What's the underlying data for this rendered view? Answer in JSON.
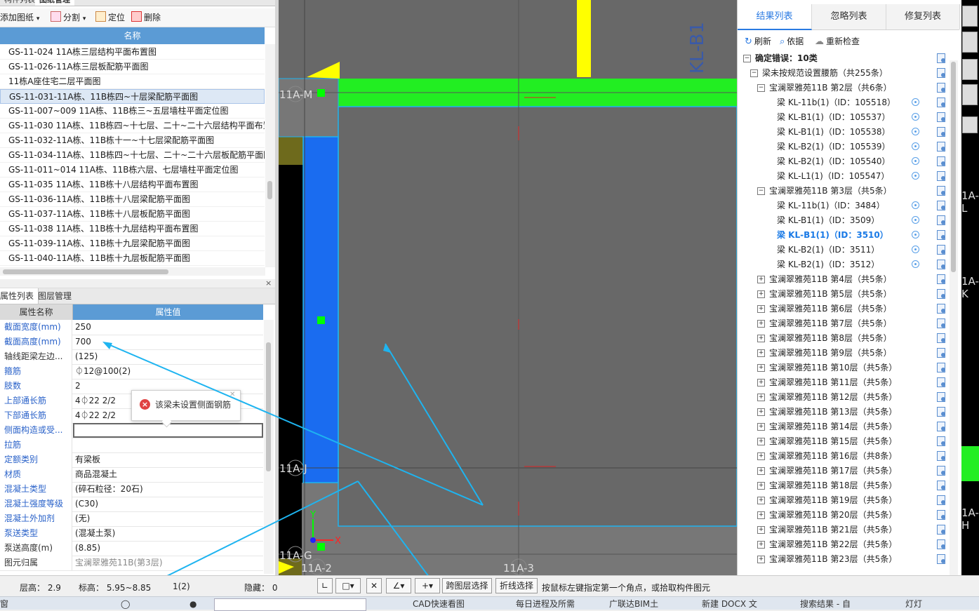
{
  "drawing_panel": {
    "tabs": [
      "构件列表",
      "图纸管理"
    ],
    "toolbar": {
      "add": "添加图纸",
      "split": "分割",
      "locate": "定位",
      "delete": "删除"
    },
    "header": "名称",
    "rows": [
      "GS-11-024 11A栋三层结构平面布置图",
      "GS-11-026-11A栋三层板配筋平面图",
      "11栋A座住宅二层平面图",
      "GS-11-031-11A栋、11B栋四~十层梁配筋平面图",
      "GS-11-007~009 11A栋、11B栋三~五层墙柱平面定位图",
      "GS-11-030 11A栋、11B栋四~十七层、二十~二十六层结构平面布置",
      "GS-11-032-11A栋、11B栋十一~十七层梁配筋平面图",
      "GS-11-034-11A栋、11B栋四~十七层、二十~二十六层板配筋平面图",
      "GS-11-011~014 11A栋、11B栋六层、七层墙柱平面定位图",
      "GS-11-035 11A栋、11B栋十八层结构平面布置图",
      "GS-11-036-11A栋、11B栋十八层梁配筋平面图",
      "GS-11-037-11A栋、11B栋十八层板配筋平面图",
      "GS-11-038 11A栋、11B栋十九层结构平面布置图",
      "GS-11-039-11A栋、11B栋十九层梁配筋平面图",
      "GS-11-040-11A栋、11B栋十九层板配筋平面图"
    ],
    "selected_index": 3
  },
  "property_panel": {
    "tabs": [
      "属性列表",
      "图层管理"
    ],
    "header_name": "属性名称",
    "header_value": "属性值",
    "rows": [
      {
        "name": "截面宽度(mm)",
        "value": "250",
        "blue": true
      },
      {
        "name": "截面高度(mm)",
        "value": "700",
        "blue": true
      },
      {
        "name": "轴线距梁左边...",
        "value": "(125)",
        "blue": false
      },
      {
        "name": "箍筋",
        "value": "⏀12@100(2)",
        "blue": true
      },
      {
        "name": "肢数",
        "value": "2",
        "blue": true
      },
      {
        "name": "上部通长筋",
        "value": "4⏀22 2/2",
        "blue": true
      },
      {
        "name": "下部通长筋",
        "value": "4⏀22 2/2",
        "blue": true
      },
      {
        "name": "侧面构造或受...",
        "value": "",
        "blue": true,
        "editing": true
      },
      {
        "name": "拉筋",
        "value": "",
        "blue": true
      },
      {
        "name": "定额类别",
        "value": "有梁板",
        "blue": true
      },
      {
        "name": "材质",
        "value": "商品混凝土",
        "blue": true
      },
      {
        "name": "混凝土类型",
        "value": "(碎石粒径：20石)",
        "blue": true
      },
      {
        "name": "混凝土强度等级",
        "value": "(C30)",
        "blue": true
      },
      {
        "name": "混凝土外加剂",
        "value": "(无)",
        "blue": true
      },
      {
        "name": "泵送类型",
        "value": "(混凝土泵)",
        "blue": true
      },
      {
        "name": "泵送高度(m)",
        "value": "(8.85)",
        "blue": false
      },
      {
        "name": "图元归属",
        "value": "宝澜翠雅苑11B(第3层)",
        "blue": false,
        "grey": true
      }
    ],
    "tooltip": "该梁未设置侧面钢筋"
  },
  "canvas": {
    "axis_labels": [
      "11A-M",
      "11A-J",
      "11A-G",
      "11A-2",
      "11A-3"
    ],
    "beam_label": "KL-B1",
    "axis_x": "X",
    "axis_y": "Y",
    "colors": {
      "green": "#22ee22",
      "blue": "#1a6cf0",
      "yellow": "#ffff00",
      "grey": "#686868",
      "olive": "#6e6a1c",
      "cyan": "#1eb4f0"
    }
  },
  "check_panel": {
    "tabs": [
      "结果列表",
      "忽略列表",
      "修复列表"
    ],
    "active_tab": 0,
    "toolbar": {
      "refresh": "刷新",
      "basis": "依据",
      "recheck": "重新检查"
    },
    "tree": [
      {
        "level": 0,
        "label": "确定错误：10类",
        "box": "−",
        "bold": true
      },
      {
        "level": 1,
        "label": "梁未按规范设置腰筋（共255条）",
        "box": "−"
      },
      {
        "level": 2,
        "label": "宝澜翠雅苑11B 第2层（共6条）",
        "box": "−"
      },
      {
        "level": 3,
        "label": "梁 KL-11b(1)（ID：105518）",
        "loc": true
      },
      {
        "level": 3,
        "label": "梁 KL-B1(1)（ID：105537）",
        "loc": true
      },
      {
        "level": 3,
        "label": "梁 KL-B1(1)（ID：105538）",
        "loc": true
      },
      {
        "level": 3,
        "label": "梁 KL-B2(1)（ID：105539）",
        "loc": true
      },
      {
        "level": 3,
        "label": "梁 KL-B2(1)（ID：105540）",
        "loc": true
      },
      {
        "level": 3,
        "label": "梁 KL-L1(1)（ID：105547）",
        "loc": true
      },
      {
        "level": 2,
        "label": "宝澜翠雅苑11B 第3层（共5条）",
        "box": "−"
      },
      {
        "level": 3,
        "label": "梁 KL-11b(1)（ID：3484）",
        "loc": true
      },
      {
        "level": 3,
        "label": "梁 KL-B1(1)（ID：3509）",
        "loc": true
      },
      {
        "level": 3,
        "label": "梁 KL-B1(1)（ID：3510）",
        "loc": true,
        "selected": true
      },
      {
        "level": 3,
        "label": "梁 KL-B2(1)（ID：3511）",
        "loc": true
      },
      {
        "level": 3,
        "label": "梁 KL-B2(1)（ID：3512）",
        "loc": true
      },
      {
        "level": 2,
        "label": "宝澜翠雅苑11B 第4层（共5条）",
        "box": "+"
      },
      {
        "level": 2,
        "label": "宝澜翠雅苑11B 第5层（共5条）",
        "box": "+"
      },
      {
        "level": 2,
        "label": "宝澜翠雅苑11B 第6层（共5条）",
        "box": "+"
      },
      {
        "level": 2,
        "label": "宝澜翠雅苑11B 第7层（共5条）",
        "box": "+"
      },
      {
        "level": 2,
        "label": "宝澜翠雅苑11B 第8层（共5条）",
        "box": "+"
      },
      {
        "level": 2,
        "label": "宝澜翠雅苑11B 第9层（共5条）",
        "box": "+"
      },
      {
        "level": 2,
        "label": "宝澜翠雅苑11B 第10层（共5条）",
        "box": "+"
      },
      {
        "level": 2,
        "label": "宝澜翠雅苑11B 第11层（共5条）",
        "box": "+"
      },
      {
        "level": 2,
        "label": "宝澜翠雅苑11B 第12层（共5条）",
        "box": "+"
      },
      {
        "level": 2,
        "label": "宝澜翠雅苑11B 第13层（共5条）",
        "box": "+"
      },
      {
        "level": 2,
        "label": "宝澜翠雅苑11B 第14层（共5条）",
        "box": "+"
      },
      {
        "level": 2,
        "label": "宝澜翠雅苑11B 第15层（共5条）",
        "box": "+"
      },
      {
        "level": 2,
        "label": "宝澜翠雅苑11B 第16层（共8条）",
        "box": "+"
      },
      {
        "level": 2,
        "label": "宝澜翠雅苑11B 第17层（共5条）",
        "box": "+"
      },
      {
        "level": 2,
        "label": "宝澜翠雅苑11B 第18层（共5条）",
        "box": "+"
      },
      {
        "level": 2,
        "label": "宝澜翠雅苑11B 第19层（共5条）",
        "box": "+"
      },
      {
        "level": 2,
        "label": "宝澜翠雅苑11B 第20层（共5条）",
        "box": "+"
      },
      {
        "level": 2,
        "label": "宝澜翠雅苑11B 第21层（共5条）",
        "box": "+"
      },
      {
        "level": 2,
        "label": "宝澜翠雅苑11B 第22层（共5条）",
        "box": "+"
      },
      {
        "level": 2,
        "label": "宝澜翠雅苑11B 第23层（共5条）",
        "box": "+"
      }
    ]
  },
  "far_right": {
    "labels": [
      "1A-L",
      "1A-K",
      "1A-H"
    ]
  },
  "status_bar": {
    "floor_height": "层高：  2.9",
    "elevation": "标高：  5.95~8.85",
    "count": "1(2)",
    "hidden": "隐藏：  0",
    "cross_layer": "跨图层选择",
    "polyline": "折线选择",
    "hint": "按鼠标左键指定第一个角点，或拾取构件图元"
  },
  "taskbar": {
    "items": [
      "窗",
      "CAD快速看图",
      "每日进程及所需",
      "广联达BIM土",
      "新建 DOCX 文",
      "搜索结果 - 自",
      "灯灯"
    ]
  }
}
